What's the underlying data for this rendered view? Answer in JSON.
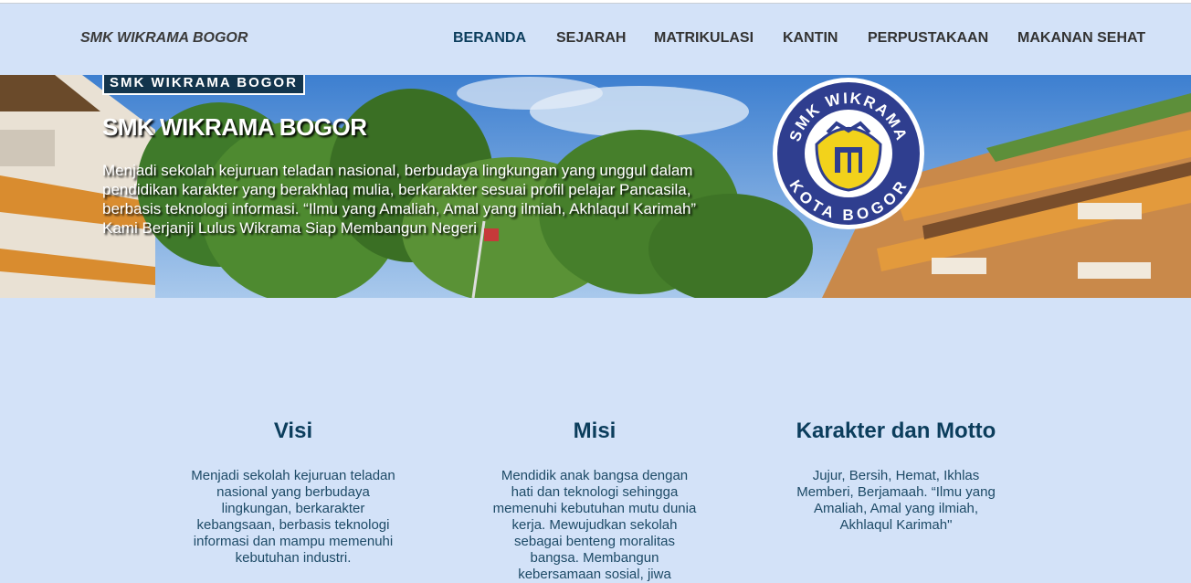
{
  "navbar": {
    "brand": "SMK WIKRAMA BOGOR",
    "items": [
      {
        "label": "BERANDA",
        "active": true
      },
      {
        "label": "SEJARAH",
        "active": false
      },
      {
        "label": "MATRIKULASI",
        "active": false
      },
      {
        "label": "KANTIN",
        "active": false
      },
      {
        "label": "PERPUSTAKAAN",
        "active": false
      },
      {
        "label": "MAKANAN SEHAT",
        "active": false
      }
    ]
  },
  "hero": {
    "tag": "SMK WIKRAMA BOGOR",
    "title": "SMK WIKRAMA BOGOR",
    "text": "Menjadi sekolah kejuruan teladan nasional, berbudaya lingkungan yang unggul dalam pendidikan karakter yang berakhlaq mulia, berkarakter sesuai profil pelajar Pancasila, berbasis teknologi informasi. “Ilmu yang Amaliah, Amal yang ilmiah, Akhlaqul Karimah” Kami Berjanji Lulus Wikrama Siap Membangun Negeri",
    "logo": {
      "top": "SMK WIKRAMA",
      "bottom": "KOTA BOGOR"
    }
  },
  "sections": [
    {
      "title": "Visi",
      "text": "Menjadi sekolah kejuruan teladan nasional yang berbudaya lingkungan, berkarakter kebangsaan, berbasis teknologi informasi dan mampu memenuhi kebutuhan industri."
    },
    {
      "title": "Misi",
      "text": "Mendidik anak bangsa dengan hati dan teknologi sehingga memenuhi kebutuhan mutu dunia kerja. Mewujudkan sekolah sebagai benteng moralitas bangsa. Membangun kebersamaan sosial, jiwa"
    },
    {
      "title": "Karakter dan Motto",
      "text": "Jujur, Bersih, Hemat, Ikhlas Memberi, Berjamaah. “Ilmu yang Amaliah, Amal yang ilmiah, Akhlaqul Karimah\""
    }
  ],
  "colors": {
    "background": "#d3e2f8",
    "accent": "#0b3d5c",
    "tag_bg": "#13354d"
  }
}
